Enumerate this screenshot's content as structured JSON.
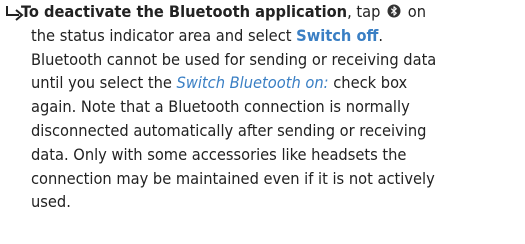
{
  "instruction": {
    "bold_lead": "To deactivate the Bluetooth application",
    "line1_after_bold": ", tap",
    "line1_after_icon": "on",
    "line2_before": "the status indicator area and select",
    "switch_off": "Switch off",
    "line2_after": ".",
    "line3": "Bluetooth cannot be used for sending or receiving data",
    "line4_before": "until you select the",
    "switch_on_label": "Switch Bluetooth on:",
    "line4_after": "check box",
    "line5": "again. Note that a Bluetooth connection is normally",
    "line6": "disconnected automatically after sending or receiving",
    "line7": "data. Only with some accessories like headsets the",
    "line8": "connection may be maintained even if it is not actively",
    "line9": "used."
  },
  "icons": {
    "arrow": "right-arrow-icon",
    "bluetooth": "bluetooth-icon"
  },
  "colors": {
    "text": "#222222",
    "accent": "#3a7fc4"
  }
}
